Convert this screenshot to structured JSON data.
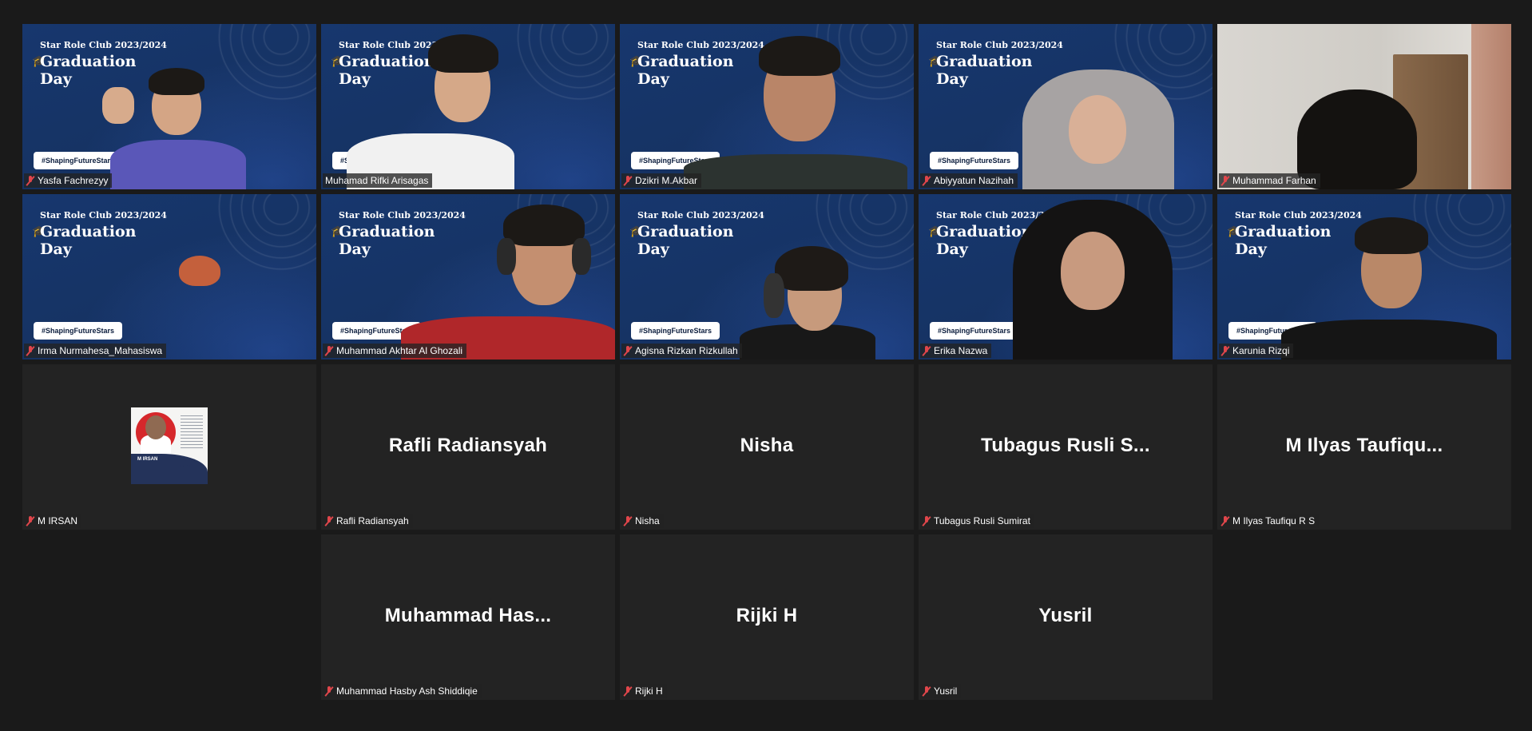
{
  "background_text": {
    "club": "Star Role Club 2023/2024",
    "title": "Graduation Day",
    "hashtag": "#ShapingFutureStars"
  },
  "colors": {
    "active_speaker_border": "#d9e86a",
    "muted_mic": "#e0464b",
    "tile_bg": "#232323",
    "page_bg": "#1a1a1a"
  },
  "participants": [
    {
      "name": "Yasfa Fachrezyy",
      "video": true,
      "muted": true
    },
    {
      "name": "Muhamad Rifki Arisagas",
      "video": true,
      "muted": false,
      "active_speaker": true
    },
    {
      "name": "Dzikri M.Akbar",
      "video": true,
      "muted": true
    },
    {
      "name": "Abiyyatun Nazihah",
      "video": true,
      "muted": true
    },
    {
      "name": "Muhammad Farhan",
      "video": true,
      "muted": true
    },
    {
      "name": "Irma Nurmahesa_Mahasiswa",
      "video": true,
      "muted": true
    },
    {
      "name": "Muhammad Akhtar Al Ghozali",
      "video": true,
      "muted": true
    },
    {
      "name": "Agisna Rizkan Rizkullah",
      "video": true,
      "muted": true
    },
    {
      "name": "Erika Nazwa",
      "video": true,
      "muted": true
    },
    {
      "name": "Karunia Rizqi",
      "video": true,
      "muted": true
    },
    {
      "name": "M IRSAN",
      "video": false,
      "muted": true,
      "profile_name": "M IRSAN"
    },
    {
      "name": "Rafli Radiansyah",
      "video": false,
      "muted": true,
      "display_name": "Rafli Radiansyah"
    },
    {
      "name": "Nisha",
      "video": false,
      "muted": true,
      "display_name": "Nisha"
    },
    {
      "name": "Tubagus Rusli Sumirat",
      "video": false,
      "muted": true,
      "display_name": "Tubagus Rusli S..."
    },
    {
      "name": "M Ilyas Taufiqu R S",
      "video": false,
      "muted": true,
      "display_name": "M Ilyas Taufiqu..."
    },
    {
      "name": "Muhammad Hasby Ash Shiddiqie",
      "video": false,
      "muted": true,
      "display_name": "Muhammad  Has..."
    },
    {
      "name": "Rijki H",
      "video": false,
      "muted": true,
      "display_name": "Rijki H"
    },
    {
      "name": "Yusril",
      "video": false,
      "muted": true,
      "display_name": "Yusril"
    }
  ]
}
